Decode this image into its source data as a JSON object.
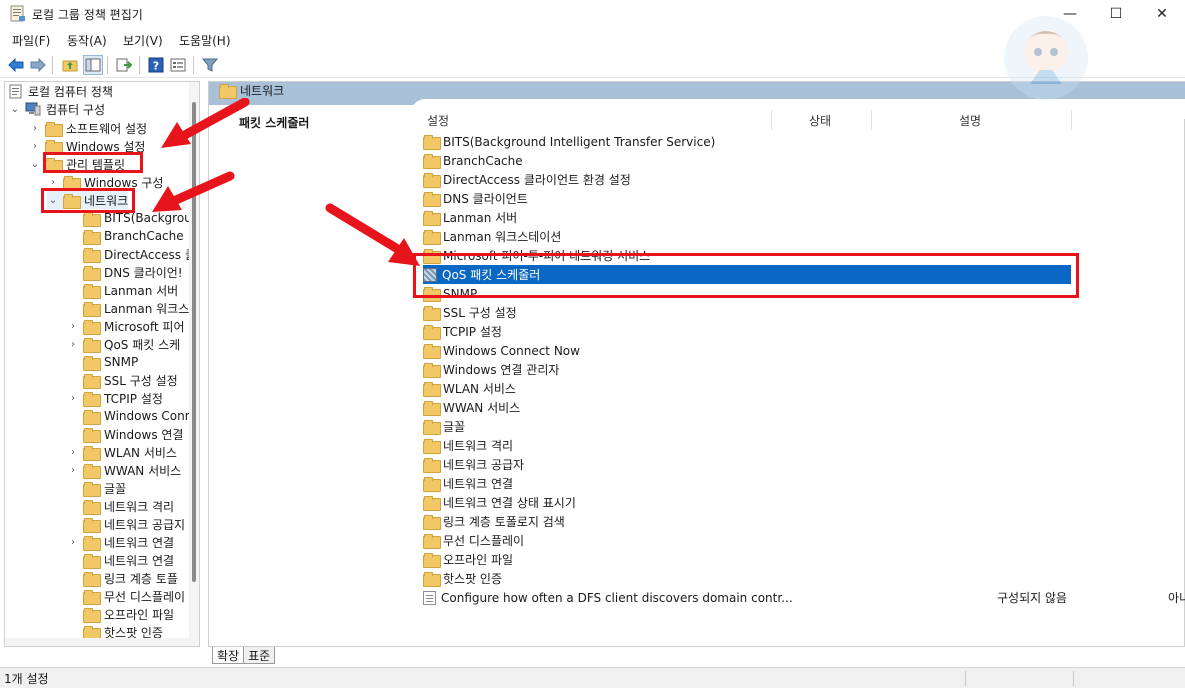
{
  "window": {
    "title": "로컬 그룹 정책 편집기",
    "minimize": "—",
    "maximize": "☐",
    "close": "✕"
  },
  "menu": [
    "파일(F)",
    "동작(A)",
    "보기(V)",
    "도움말(H)"
  ],
  "toolbar": {
    "back": "back-arrow-icon",
    "forward": "forward-arrow-icon",
    "up": "up-folder-icon",
    "show_hide": "show-hide-tree-icon",
    "export": "export-list-icon",
    "help": "help-icon",
    "properties": "properties-icon",
    "filter": "filter-icon"
  },
  "tree": {
    "root": "로컬 컴퓨터 정책",
    "computer_config": "컴퓨터 구성",
    "software_settings": "소프트웨어 설정",
    "windows_settings": "Windows 설정",
    "admin_templates": "관리 템플릿",
    "windows_components": "Windows 구성",
    "network": "네트워크",
    "children": [
      {
        "label": "BITS(Backgrour",
        "expandable": false
      },
      {
        "label": "BranchCache",
        "expandable": false
      },
      {
        "label": "DirectAccess 클",
        "expandable": false
      },
      {
        "label": "DNS 클라이언!",
        "expandable": false
      },
      {
        "label": "Lanman 서버",
        "expandable": false
      },
      {
        "label": "Lanman 워크스",
        "expandable": false
      },
      {
        "label": "Microsoft 피어",
        "expandable": true
      },
      {
        "label": "QoS 패킷 스케",
        "expandable": true
      },
      {
        "label": "SNMP",
        "expandable": false
      },
      {
        "label": "SSL 구성 설정",
        "expandable": false
      },
      {
        "label": "TCPIP 설정",
        "expandable": true
      },
      {
        "label": "Windows Conn",
        "expandable": false
      },
      {
        "label": "Windows 연결",
        "expandable": false
      },
      {
        "label": "WLAN 서비스",
        "expandable": true
      },
      {
        "label": "WWAN 서비스",
        "expandable": true
      },
      {
        "label": "글꼴",
        "expandable": false
      },
      {
        "label": "네트워크 격리",
        "expandable": false
      },
      {
        "label": "네트워크 공급지",
        "expandable": false
      },
      {
        "label": "네트워크 연결",
        "expandable": true
      },
      {
        "label": "네트워크 연결",
        "expandable": false
      },
      {
        "label": "링크 계층 토플",
        "expandable": false
      },
      {
        "label": "무선 디스플레이",
        "expandable": false
      },
      {
        "label": "오프라인 파일",
        "expandable": false
      },
      {
        "label": "핫스팟 인증",
        "expandable": false
      }
    ]
  },
  "right": {
    "header": "네트워크",
    "left_label": "패킷 스케줄러",
    "columns": {
      "setting": "설정",
      "state": "상태",
      "description": "설명"
    },
    "rows": [
      {
        "label": "BITS(Background Intelligent Transfer Service)",
        "kind": "folder"
      },
      {
        "label": "BranchCache",
        "kind": "folder"
      },
      {
        "label": "DirectAccess 클라이언트 환경 설정",
        "kind": "folder"
      },
      {
        "label": "DNS 클라이언트",
        "kind": "folder"
      },
      {
        "label": "Lanman 서버",
        "kind": "folder"
      },
      {
        "label": "Lanman 워크스테이션",
        "kind": "folder"
      },
      {
        "label": "Microsoft 피어-투-피어 네트워킹 서비스",
        "kind": "folder"
      },
      {
        "label": "QoS 패킷 스케줄러",
        "kind": "qos",
        "selected": true
      },
      {
        "label": "SNMP",
        "kind": "folder"
      },
      {
        "label": "SSL 구성 설정",
        "kind": "folder"
      },
      {
        "label": "TCPIP 설정",
        "kind": "folder"
      },
      {
        "label": "Windows Connect Now",
        "kind": "folder"
      },
      {
        "label": "Windows 연결 관리자",
        "kind": "folder"
      },
      {
        "label": "WLAN 서비스",
        "kind": "folder"
      },
      {
        "label": "WWAN 서비스",
        "kind": "folder"
      },
      {
        "label": "글꼴",
        "kind": "folder"
      },
      {
        "label": "네트워크 격리",
        "kind": "folder"
      },
      {
        "label": "네트워크 공급자",
        "kind": "folder"
      },
      {
        "label": "네트워크 연결",
        "kind": "folder"
      },
      {
        "label": "네트워크 연결 상태 표시기",
        "kind": "folder"
      },
      {
        "label": "링크 계층 토폴로지 검색",
        "kind": "folder"
      },
      {
        "label": "무선 디스플레이",
        "kind": "folder"
      },
      {
        "label": "오프라인 파일",
        "kind": "folder"
      },
      {
        "label": "핫스팟 인증",
        "kind": "folder"
      },
      {
        "label": "Configure how often a DFS client discovers domain contr...",
        "kind": "policy",
        "state": "구성되지 않음",
        "support": "아니요"
      }
    ]
  },
  "tabs": [
    "확장",
    "표준"
  ],
  "status": "1개 설정",
  "colors": {
    "selection": "#0a67c4",
    "header_band": "#a8c0d8",
    "annotation": "#e8141c",
    "folder": "#f2c866"
  }
}
